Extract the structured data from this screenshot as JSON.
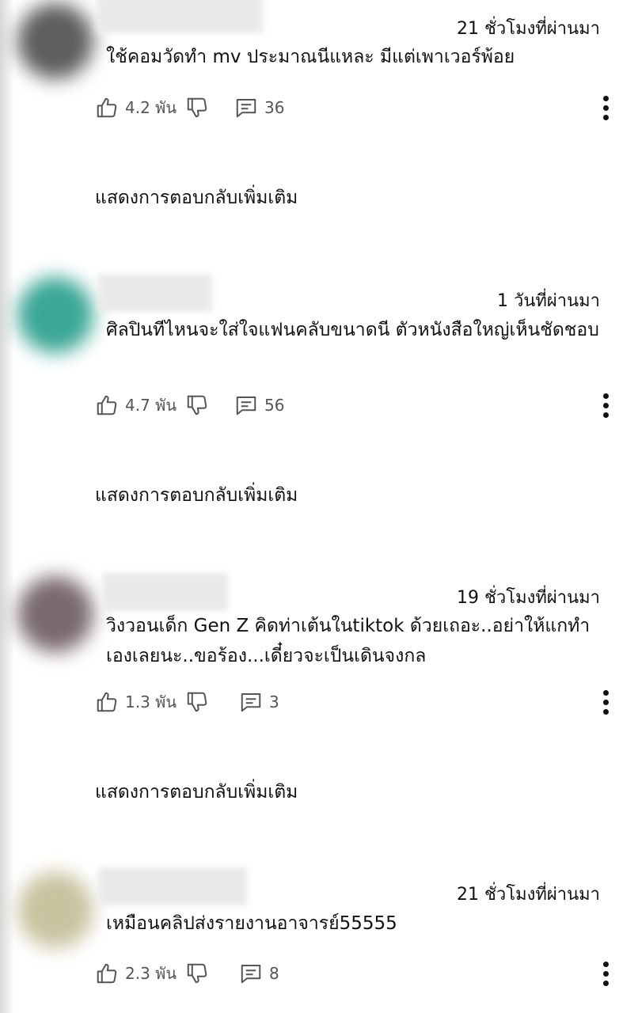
{
  "comments": [
    {
      "time": "21 ชั่วโมงที่ผ่านมา",
      "text": "ใช้คอมวัดทำ mv ประมาณนีแหละ มีแต่เพาเวอร์พ้อย",
      "likes": "4.2 พัน",
      "replies": "36",
      "show_more": "แสดงการตอบกลับเพิ่มเติม",
      "avatar_color": "#5e5e5e"
    },
    {
      "time": "1 วันที่ผ่านมา",
      "text": "ศิลปินทีไหนจะใส่ใจแฟนคลับขนาดนี ตัวหนังสือใหญ่เห็นชัดชอบ",
      "likes": "4.7 พัน",
      "replies": "56",
      "show_more": "แสดงการตอบกลับเพิ่มเติม",
      "avatar_color": "#3aa795"
    },
    {
      "time": "19 ชั่วโมงที่ผ่านมา",
      "text": "วิงวอนเด็ก Gen Z คิดท่าเต้นในtiktok ด้วยเถอะ..อย่าให้แกทำเองเลยนะ..ขอร้อง...เดี๋ยวจะเป็นเดินจงกล",
      "likes": "1.3 พัน",
      "replies": "3",
      "show_more": "แสดงการตอบกลับเพิ่มเติม",
      "avatar_color": "#7a6a70"
    },
    {
      "time": "21 ชั่วโมงที่ผ่านมา",
      "text": "เหมือนคลิปส่งรายงานอาจารย์55555",
      "likes": "2.3 พัน",
      "replies": "8",
      "avatar_color": "#c9c3a0"
    }
  ]
}
